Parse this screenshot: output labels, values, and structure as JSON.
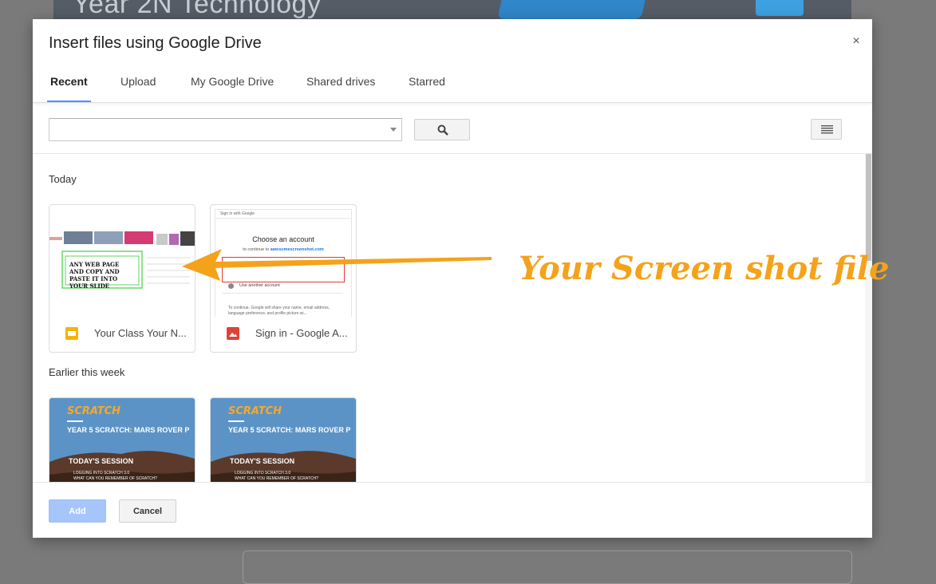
{
  "background": {
    "banner_title": "Year 2N Technology"
  },
  "dialog": {
    "title": "Insert files using Google Drive",
    "close_label": "×"
  },
  "tabs": [
    {
      "label": "Recent",
      "active": true
    },
    {
      "label": "Upload"
    },
    {
      "label": "My Google Drive"
    },
    {
      "label": "Shared drives"
    },
    {
      "label": "Starred"
    }
  ],
  "search": {
    "value": "",
    "placeholder": "",
    "search_icon": "search-icon",
    "view_icon": "list-view-icon"
  },
  "sections": {
    "today": "Today",
    "earlier": "Earlier this week"
  },
  "files_today": [
    {
      "name": "Your Class Your N...",
      "icon": "slides-icon",
      "icon_color": "#f4b400",
      "thumb_text": "ANY WEB PAGE AND COPY AND PASTE IT INTO YOUR SLIDE"
    },
    {
      "name": "Sign in - Google A...",
      "icon": "image-icon",
      "icon_color": "#db4437",
      "thumb_header": "Sign in with Google",
      "thumb_title": "Choose an account",
      "thumb_sub_prefix": "to continue to ",
      "thumb_sub_link": "awesomescreenshot.com",
      "thumb_other": "Use another account",
      "thumb_footer": "To continue, Google will share your name, email address, language preference, and profile picture wi..."
    }
  ],
  "files_earlier": [
    {
      "logo": "SCRATCH",
      "heading": "YEAR 5 SCRATCH: MARS ROVER P",
      "session": "TODAY'S SESSION",
      "bullets": [
        "LOGGING INTO SCRATCH 3.0",
        "WHAT CAN YOU REMEMBER OF SCRATCH?"
      ]
    },
    {
      "logo": "SCRATCH",
      "heading": "YEAR 5 SCRATCH: MARS ROVER P",
      "session": "TODAY'S SESSION",
      "bullets": [
        "LOGGING INTO SCRATCH 3.0",
        "WHAT CAN YOU REMEMBER OF SCRATCH?"
      ]
    }
  ],
  "footer": {
    "add_label": "Add",
    "cancel_label": "Cancel"
  },
  "annotation": {
    "text": "Your Screen shot file",
    "color": "#f5a21b"
  },
  "colors": {
    "accent": "#4d90fe",
    "add_disabled": "#a6c6fb",
    "overlay": "#7a7a7a"
  }
}
